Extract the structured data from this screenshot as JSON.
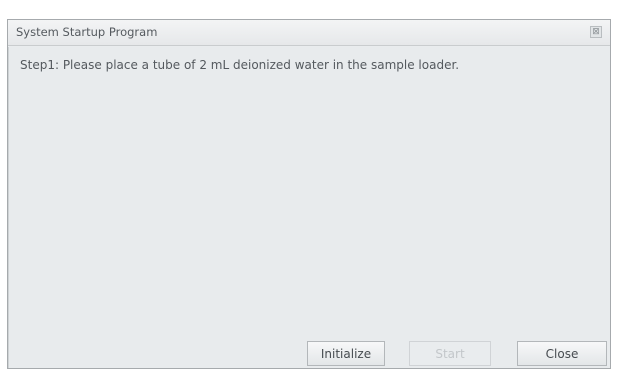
{
  "window": {
    "title": "System Startup Program",
    "close_glyph": "⊠"
  },
  "content": {
    "step_text": "Step1:  Please place a tube of 2 mL deionized water in the sample loader."
  },
  "buttons": {
    "initialize_label": "Initialize",
    "start_label": "Start",
    "close_label": "Close",
    "start_enabled": false
  }
}
